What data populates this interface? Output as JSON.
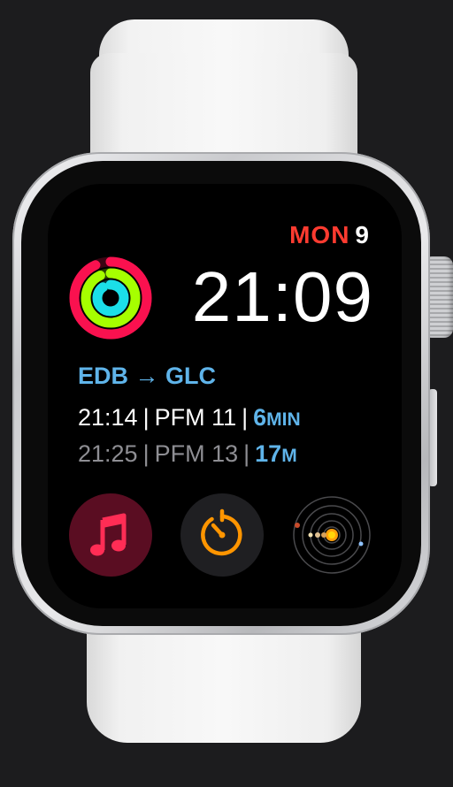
{
  "watch_face": {
    "date": {
      "weekday": "MON",
      "day": "9"
    },
    "time": "21:09",
    "activity": {
      "rings": [
        {
          "name": "move",
          "color": "#fa114f",
          "progress": 0.93
        },
        {
          "name": "exercise",
          "color": "#a6ff00",
          "progress": 0.93
        },
        {
          "name": "stand",
          "color": "#1bdfe8",
          "progress": 0.9
        }
      ]
    },
    "train": {
      "route_from": "EDB",
      "route_arrow": "→",
      "route_to": "GLC",
      "departures": [
        {
          "time": "21:14",
          "platform": "PFM 11",
          "wait_value": "6",
          "wait_unit": "MIN"
        },
        {
          "time": "21:25",
          "platform": "PFM 13",
          "wait_value": "17",
          "wait_unit": "M"
        }
      ]
    },
    "complications": [
      {
        "name": "music",
        "icon": "music-note-icon",
        "color": "#ff2d55"
      },
      {
        "name": "timer",
        "icon": "timer-icon",
        "color": "#ff9500"
      },
      {
        "name": "solar-system",
        "icon": "solar-system-icon",
        "color": "#ff9f0a"
      }
    ]
  }
}
